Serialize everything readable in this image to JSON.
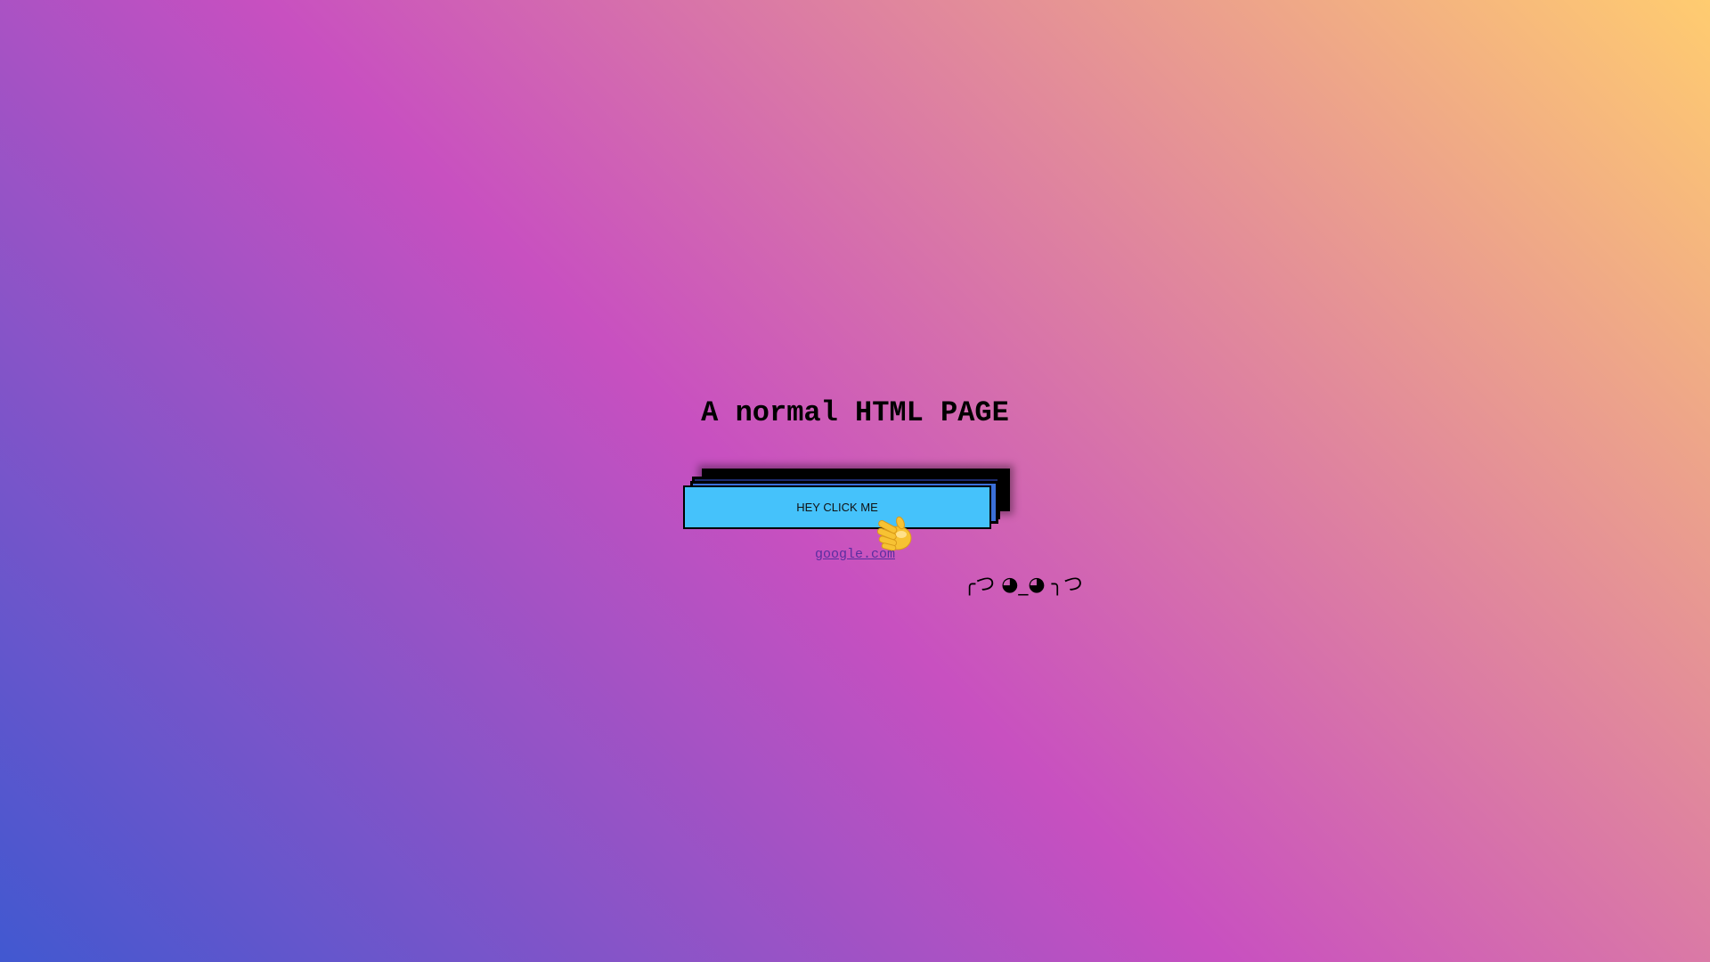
{
  "page": {
    "title": "A normal HTML PAGE"
  },
  "button": {
    "label": "HEY CLICK ME"
  },
  "link": {
    "text": "google.com",
    "href": "https://google.com"
  },
  "kaomoji": "╭つ ◕_◕ ╮つ",
  "icons": {
    "pointer": "waving-hand-icon"
  },
  "colors": {
    "gradient": [
      "#4158d0",
      "#c850c0",
      "#ffcc70"
    ],
    "button": "#45c2fb",
    "link": "#5a2ea0"
  }
}
